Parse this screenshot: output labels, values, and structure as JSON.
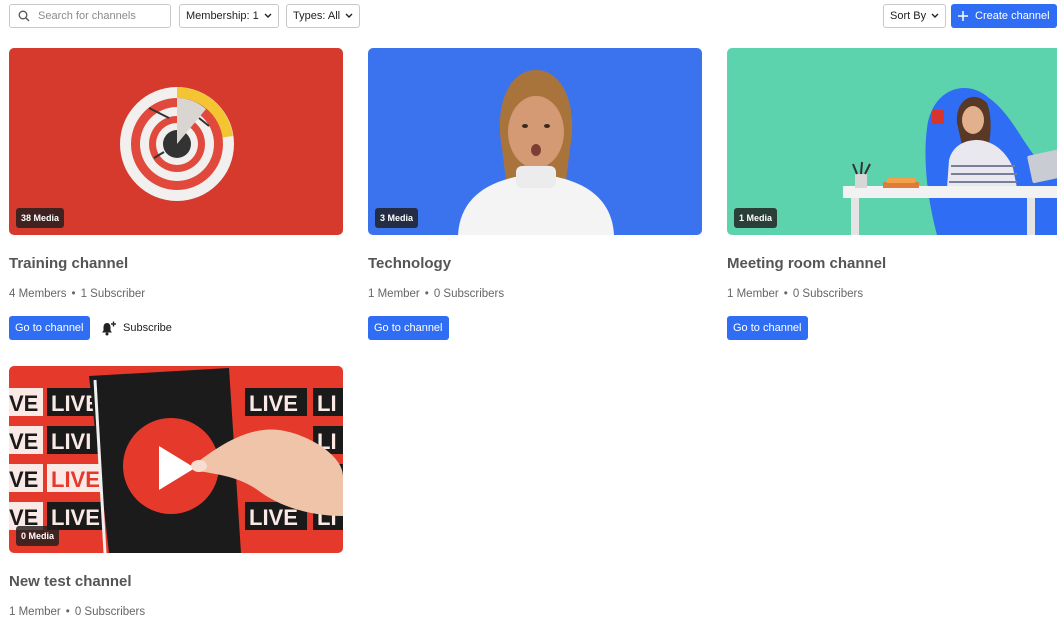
{
  "toolbar": {
    "search_placeholder": "Search for channels",
    "membership_filter": "Membership: 1",
    "types_filter": "Types: All",
    "sort_label": "Sort By",
    "create_label": "Create channel"
  },
  "colors": {
    "accent": "#2f6df5",
    "badge_bg": "#1e1e1e"
  },
  "channels": [
    {
      "title": "Training channel",
      "media_count": "38 Media",
      "members": "4 Members",
      "subscribers": "1 Subscriber",
      "go_label": "Go to channel",
      "subscribe_label": "Subscribe",
      "thumbnail": "target-dartboard",
      "thumb_color": "#d63a2c"
    },
    {
      "title": "Technology",
      "media_count": "3 Media",
      "members": "1 Member",
      "subscribers": "0 Subscribers",
      "go_label": "Go to channel",
      "thumbnail": "surprised-woman",
      "thumb_color": "#3b73ef"
    },
    {
      "title": "Meeting room channel",
      "media_count": "1 Media",
      "members": "1 Member",
      "subscribers": "0 Subscribers",
      "go_label": "Go to channel",
      "thumbnail": "woman-at-desk",
      "thumb_color": "#5cd3ad"
    },
    {
      "title": "New test channel",
      "media_count": "0 Media",
      "members": "1 Member",
      "subscribers": "0 Subscribers",
      "thumbnail": "live-play-phone",
      "thumb_color": "#e5392b",
      "thumb_text": "LIVE"
    }
  ],
  "separator": "•"
}
